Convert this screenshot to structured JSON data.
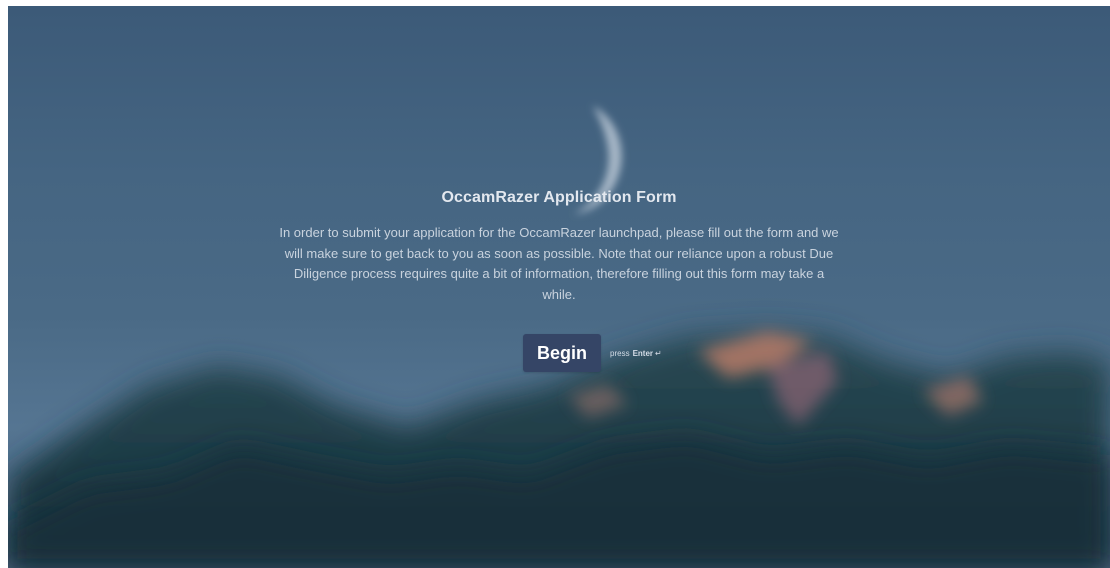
{
  "form": {
    "title": "OccamRazer Application Form",
    "description": "In order to submit your application for the OccamRazer launchpad, please fill out the form and we will make sure to get back to you as soon as possible. Note that our reliance upon a robust Due Diligence process requires quite a bit of information, therefore filling out this form may take a while.",
    "begin_label": "Begin",
    "hint_prefix": "press",
    "hint_key": "Enter",
    "enter_icon": "enter-arrow-icon"
  },
  "colors": {
    "button_bg": "#354566",
    "sky_top": "#3c5a78",
    "sky_bottom": "#557592",
    "mountain": "#1f3a44",
    "title_text": "#e3e8ef"
  }
}
